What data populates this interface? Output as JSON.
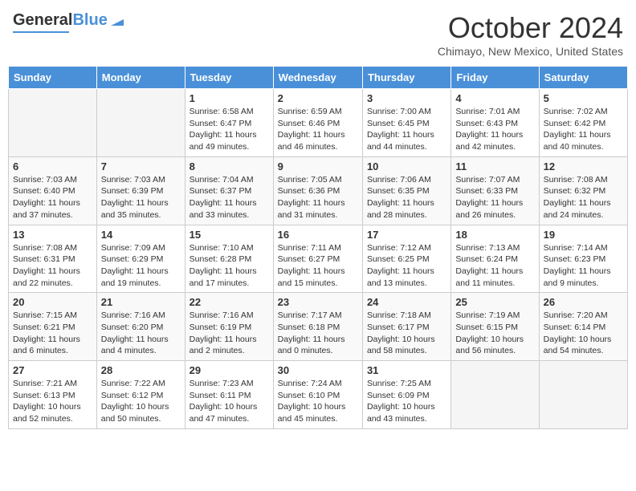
{
  "header": {
    "logo_general": "General",
    "logo_blue": "Blue",
    "month_title": "October 2024",
    "location": "Chimayo, New Mexico, United States"
  },
  "days_of_week": [
    "Sunday",
    "Monday",
    "Tuesday",
    "Wednesday",
    "Thursday",
    "Friday",
    "Saturday"
  ],
  "weeks": [
    [
      {
        "day": "",
        "info": ""
      },
      {
        "day": "",
        "info": ""
      },
      {
        "day": "1",
        "info": "Sunrise: 6:58 AM\nSunset: 6:47 PM\nDaylight: 11 hours and 49 minutes."
      },
      {
        "day": "2",
        "info": "Sunrise: 6:59 AM\nSunset: 6:46 PM\nDaylight: 11 hours and 46 minutes."
      },
      {
        "day": "3",
        "info": "Sunrise: 7:00 AM\nSunset: 6:45 PM\nDaylight: 11 hours and 44 minutes."
      },
      {
        "day": "4",
        "info": "Sunrise: 7:01 AM\nSunset: 6:43 PM\nDaylight: 11 hours and 42 minutes."
      },
      {
        "day": "5",
        "info": "Sunrise: 7:02 AM\nSunset: 6:42 PM\nDaylight: 11 hours and 40 minutes."
      }
    ],
    [
      {
        "day": "6",
        "info": "Sunrise: 7:03 AM\nSunset: 6:40 PM\nDaylight: 11 hours and 37 minutes."
      },
      {
        "day": "7",
        "info": "Sunrise: 7:03 AM\nSunset: 6:39 PM\nDaylight: 11 hours and 35 minutes."
      },
      {
        "day": "8",
        "info": "Sunrise: 7:04 AM\nSunset: 6:37 PM\nDaylight: 11 hours and 33 minutes."
      },
      {
        "day": "9",
        "info": "Sunrise: 7:05 AM\nSunset: 6:36 PM\nDaylight: 11 hours and 31 minutes."
      },
      {
        "day": "10",
        "info": "Sunrise: 7:06 AM\nSunset: 6:35 PM\nDaylight: 11 hours and 28 minutes."
      },
      {
        "day": "11",
        "info": "Sunrise: 7:07 AM\nSunset: 6:33 PM\nDaylight: 11 hours and 26 minutes."
      },
      {
        "day": "12",
        "info": "Sunrise: 7:08 AM\nSunset: 6:32 PM\nDaylight: 11 hours and 24 minutes."
      }
    ],
    [
      {
        "day": "13",
        "info": "Sunrise: 7:08 AM\nSunset: 6:31 PM\nDaylight: 11 hours and 22 minutes."
      },
      {
        "day": "14",
        "info": "Sunrise: 7:09 AM\nSunset: 6:29 PM\nDaylight: 11 hours and 19 minutes."
      },
      {
        "day": "15",
        "info": "Sunrise: 7:10 AM\nSunset: 6:28 PM\nDaylight: 11 hours and 17 minutes."
      },
      {
        "day": "16",
        "info": "Sunrise: 7:11 AM\nSunset: 6:27 PM\nDaylight: 11 hours and 15 minutes."
      },
      {
        "day": "17",
        "info": "Sunrise: 7:12 AM\nSunset: 6:25 PM\nDaylight: 11 hours and 13 minutes."
      },
      {
        "day": "18",
        "info": "Sunrise: 7:13 AM\nSunset: 6:24 PM\nDaylight: 11 hours and 11 minutes."
      },
      {
        "day": "19",
        "info": "Sunrise: 7:14 AM\nSunset: 6:23 PM\nDaylight: 11 hours and 9 minutes."
      }
    ],
    [
      {
        "day": "20",
        "info": "Sunrise: 7:15 AM\nSunset: 6:21 PM\nDaylight: 11 hours and 6 minutes."
      },
      {
        "day": "21",
        "info": "Sunrise: 7:16 AM\nSunset: 6:20 PM\nDaylight: 11 hours and 4 minutes."
      },
      {
        "day": "22",
        "info": "Sunrise: 7:16 AM\nSunset: 6:19 PM\nDaylight: 11 hours and 2 minutes."
      },
      {
        "day": "23",
        "info": "Sunrise: 7:17 AM\nSunset: 6:18 PM\nDaylight: 11 hours and 0 minutes."
      },
      {
        "day": "24",
        "info": "Sunrise: 7:18 AM\nSunset: 6:17 PM\nDaylight: 10 hours and 58 minutes."
      },
      {
        "day": "25",
        "info": "Sunrise: 7:19 AM\nSunset: 6:15 PM\nDaylight: 10 hours and 56 minutes."
      },
      {
        "day": "26",
        "info": "Sunrise: 7:20 AM\nSunset: 6:14 PM\nDaylight: 10 hours and 54 minutes."
      }
    ],
    [
      {
        "day": "27",
        "info": "Sunrise: 7:21 AM\nSunset: 6:13 PM\nDaylight: 10 hours and 52 minutes."
      },
      {
        "day": "28",
        "info": "Sunrise: 7:22 AM\nSunset: 6:12 PM\nDaylight: 10 hours and 50 minutes."
      },
      {
        "day": "29",
        "info": "Sunrise: 7:23 AM\nSunset: 6:11 PM\nDaylight: 10 hours and 47 minutes."
      },
      {
        "day": "30",
        "info": "Sunrise: 7:24 AM\nSunset: 6:10 PM\nDaylight: 10 hours and 45 minutes."
      },
      {
        "day": "31",
        "info": "Sunrise: 7:25 AM\nSunset: 6:09 PM\nDaylight: 10 hours and 43 minutes."
      },
      {
        "day": "",
        "info": ""
      },
      {
        "day": "",
        "info": ""
      }
    ]
  ]
}
